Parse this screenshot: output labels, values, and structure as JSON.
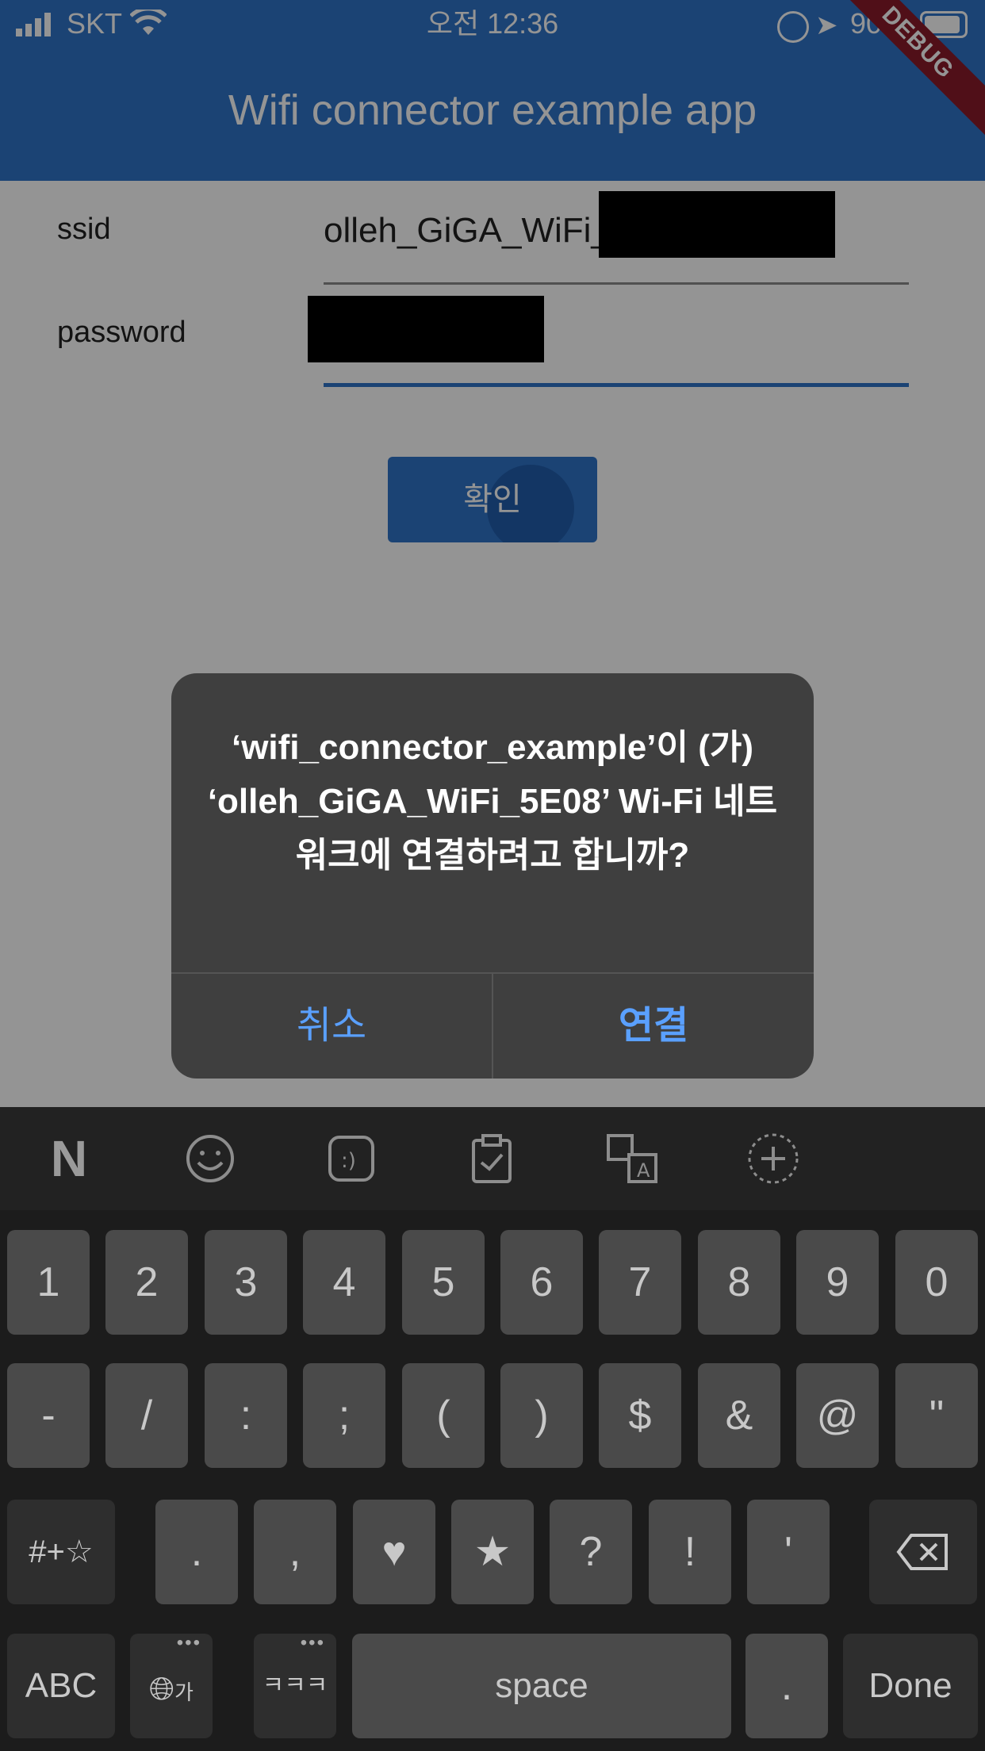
{
  "status_bar": {
    "carrier": "SKT",
    "time": "오전 12:36",
    "battery": "90%"
  },
  "app_bar": {
    "title": "Wifi connector example app",
    "debug_banner": "DEBUG"
  },
  "form": {
    "ssid_label": "ssid",
    "ssid_value": "olleh_GiGA_WiFi_",
    "password_label": "password",
    "confirm_button": "확인"
  },
  "alert": {
    "message": "‘wifi_connector_example’이 (가) ‘olleh_GiGA_WiFi_5E08’ Wi-Fi 네트워크에 연결하려고 합니까?",
    "cancel_label": "취소",
    "connect_label": "연결",
    "accent_color": "#5aa0ff"
  },
  "keyboard": {
    "toolbar_icons": [
      "naver-n-icon",
      "emoji-icon",
      "emoticon-icon",
      "clipboard-icon",
      "translate-icon",
      "add-icon"
    ],
    "row1": [
      "1",
      "2",
      "3",
      "4",
      "5",
      "6",
      "7",
      "8",
      "9",
      "0"
    ],
    "row2": [
      "-",
      "/",
      ":",
      ";",
      "(",
      ")",
      "$",
      "&",
      "@",
      "\""
    ],
    "row3_mode": "#+☆",
    "row3": [
      ".",
      ",",
      "♥",
      "★",
      "?",
      "!",
      "'"
    ],
    "abc": "ABC",
    "space": "space",
    "done": "Done",
    "korean_keys": "ㅋㅋㅋ",
    "period_key": ".",
    "globe_label": "가"
  },
  "colors": {
    "app_bar": "#2f74c9",
    "keyboard_bg": "#1c1c1c",
    "key_bg": "#4a4a4a"
  }
}
